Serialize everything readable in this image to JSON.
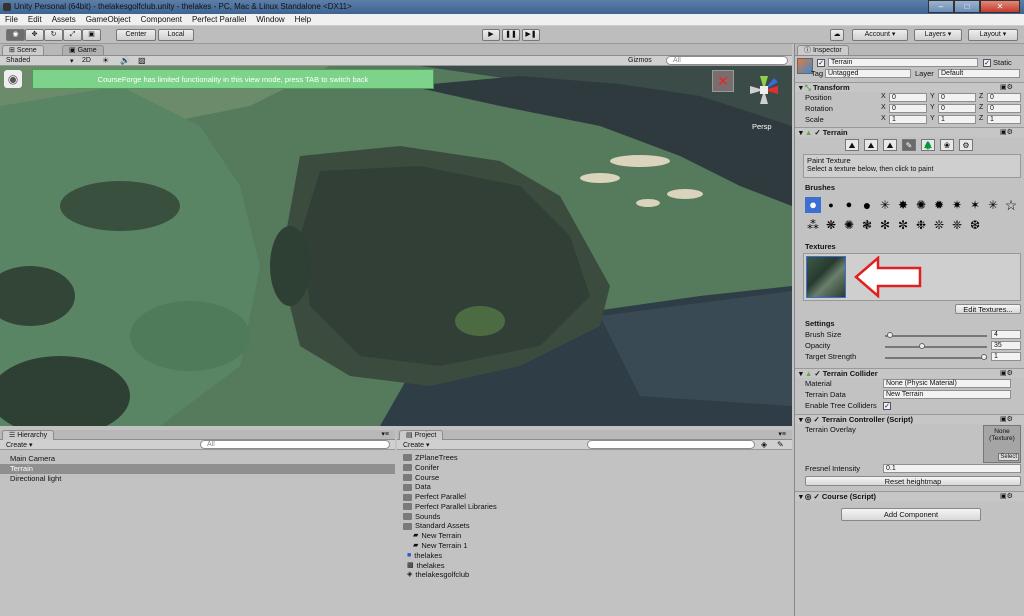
{
  "window": {
    "title": "Unity Personal (64bit) - thelakesgolfclub.unity - thelakes - PC, Mac & Linux Standalone <DX11>"
  },
  "menu": [
    "File",
    "Edit",
    "Assets",
    "GameObject",
    "Component",
    "Perfect Parallel",
    "Window",
    "Help"
  ],
  "toolbar": {
    "pivot": "Center",
    "space": "Local",
    "account": "Account",
    "layers": "Layers",
    "layout": "Layout"
  },
  "scene": {
    "tab_scene": "Scene",
    "tab_game": "Game",
    "shading": "Shaded",
    "mode_2d": "2D",
    "gizmos": "Gizmos",
    "search_placeholder": "All",
    "banner": "CourseForge has limited functionality in this view mode, press TAB to switch back",
    "persp": "Persp"
  },
  "hierarchy": {
    "title": "Hierarchy",
    "create": "Create",
    "search": "All",
    "items": [
      "Main Camera",
      "Terrain",
      "Directional light"
    ],
    "selected": "Terrain"
  },
  "project": {
    "title": "Project",
    "create": "Create",
    "items": [
      {
        "name": "ZPlaneTrees",
        "icon": "folder-icon"
      },
      {
        "name": "Conifer",
        "icon": "folder-icon"
      },
      {
        "name": "Course",
        "icon": "folder-icon"
      },
      {
        "name": "Data",
        "icon": "folder-icon"
      },
      {
        "name": "Perfect Parallel",
        "icon": "folder-icon"
      },
      {
        "name": "Perfect Parallel Libraries",
        "icon": "folder-icon"
      },
      {
        "name": "Sounds",
        "icon": "folder-icon"
      },
      {
        "name": "Standard Assets",
        "icon": "folder-icon"
      },
      {
        "name": "New Terrain",
        "icon": "terrain-asset-icon"
      },
      {
        "name": "New Terrain 1",
        "icon": "terrain-asset-icon"
      },
      {
        "name": "thelakes",
        "icon": "scene-icon"
      },
      {
        "name": "thelakes",
        "icon": "data-icon"
      },
      {
        "name": "thelakesgolfclub",
        "icon": "unity-scene-icon"
      }
    ]
  },
  "inspector": {
    "title": "Inspector",
    "object_name": "Terrain",
    "static": "Static",
    "tag_label": "Tag",
    "tag_value": "Untagged",
    "layer_label": "Layer",
    "layer_value": "Default",
    "transform": {
      "title": "Transform",
      "rows": [
        {
          "label": "Position",
          "x": "0",
          "y": "0",
          "z": "0"
        },
        {
          "label": "Rotation",
          "x": "0",
          "y": "0",
          "z": "0"
        },
        {
          "label": "Scale",
          "x": "1",
          "y": "1",
          "z": "1"
        }
      ],
      "axis_x": "X",
      "axis_y": "Y",
      "axis_z": "Z"
    },
    "terrain": {
      "title": "Terrain",
      "tool_title": "Paint Texture",
      "tool_hint": "Select a texture below, then click to paint",
      "brushes_label": "Brushes",
      "textures_label": "Textures",
      "edit_textures": "Edit Textures...",
      "settings_label": "Settings",
      "settings": [
        {
          "label": "Brush Size",
          "value": "4",
          "level": 0.02
        },
        {
          "label": "Opacity",
          "value": "35",
          "level": 0.35
        },
        {
          "label": "Target Strength",
          "value": "1",
          "level": 1.0
        }
      ]
    },
    "collider": {
      "title": "Terrain Collider",
      "material_label": "Material",
      "material_value": "None (Physic Material)",
      "data_label": "Terrain Data",
      "data_value": "New Terrain",
      "trees_label": "Enable Tree Colliders"
    },
    "controller": {
      "title": "Terrain Controller (Script)",
      "overlay_label": "Terrain Overlay",
      "overlay_value": "None (Texture)",
      "select": "Select",
      "fresnel_label": "Fresnel Intensity",
      "fresnel_value": "0.1",
      "reset": "Reset heightmap"
    },
    "course": {
      "title": "Course (Script)"
    },
    "add_component": "Add Component"
  },
  "colors": {
    "accent_green": "#7ed38a",
    "arrow_red": "#e02020",
    "selected_row": "#8f8f8f"
  }
}
